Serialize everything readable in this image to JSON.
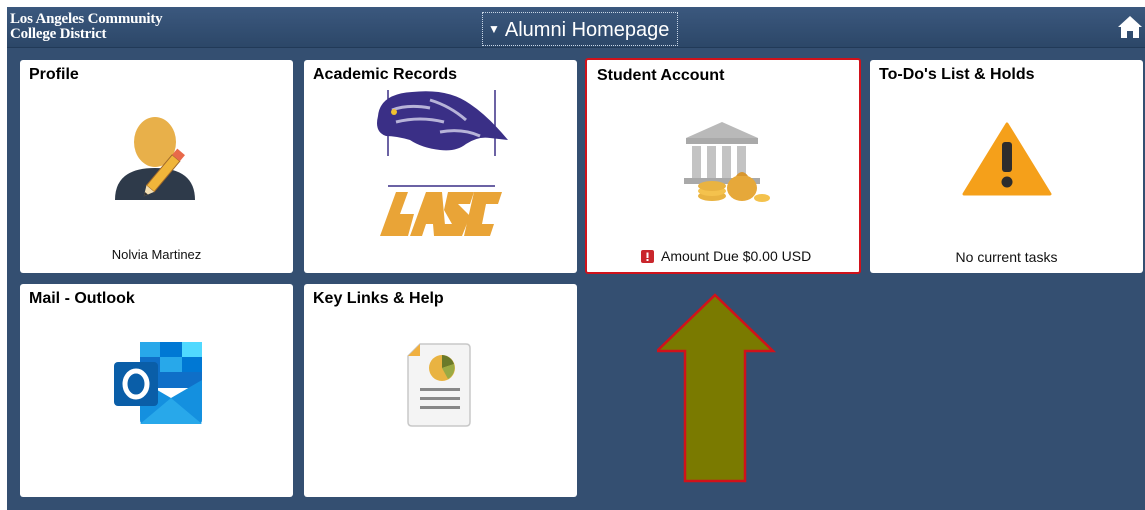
{
  "header": {
    "logo_line1": "Los Angeles Community",
    "logo_line2": "College District",
    "page_selector_label": "Alumni Homepage",
    "home_icon": "home-icon"
  },
  "tiles": [
    {
      "title": "Profile",
      "footer": "Nolvia Martinez",
      "icon": "profile-edit-icon"
    },
    {
      "title": "Academic Records",
      "footer": "",
      "icon": "lasc-cougar-logo"
    },
    {
      "title": "Student Account",
      "footer": "Amount Due $0.00 USD",
      "icon": "bank-money-icon",
      "alert_icon": "alert-icon",
      "selected": true
    },
    {
      "title": "To-Do's List & Holds",
      "footer": "No current tasks",
      "icon": "warning-icon"
    },
    {
      "title": "Mail - Outlook",
      "footer": "",
      "icon": "outlook-icon"
    },
    {
      "title": "Key Links & Help",
      "footer": "",
      "icon": "document-chart-icon"
    }
  ],
  "annotation": {
    "shape": "up-arrow",
    "fill": "#7a7a00",
    "stroke": "#d0121b"
  },
  "colors": {
    "background": "#344f71",
    "selected_border": "#d0121b",
    "alert": "#c9262c",
    "warning": "#f5a01a"
  }
}
